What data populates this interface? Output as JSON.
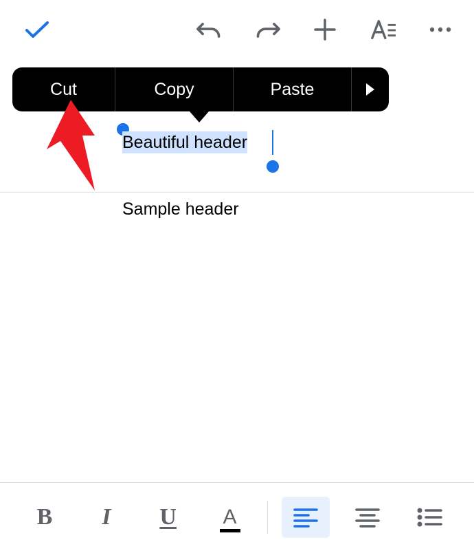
{
  "toolbar": {
    "check_label": "Done",
    "undo_label": "Undo",
    "redo_label": "Redo",
    "add_label": "Add",
    "format_label": "Format",
    "more_label": "More"
  },
  "context_menu": {
    "cut": "Cut",
    "copy": "Copy",
    "paste": "Paste",
    "more_label": "More options"
  },
  "document": {
    "selected_header": "Beautiful header",
    "body_text": "Sample header"
  },
  "format_bar": {
    "bold": "B",
    "italic": "I",
    "underline": "U",
    "text_color": "A",
    "align_left_label": "Align left",
    "align_center_label": "Align center",
    "list_label": "Bulleted list",
    "active_alignment": "left"
  },
  "annotation": {
    "target": "cut-button"
  }
}
